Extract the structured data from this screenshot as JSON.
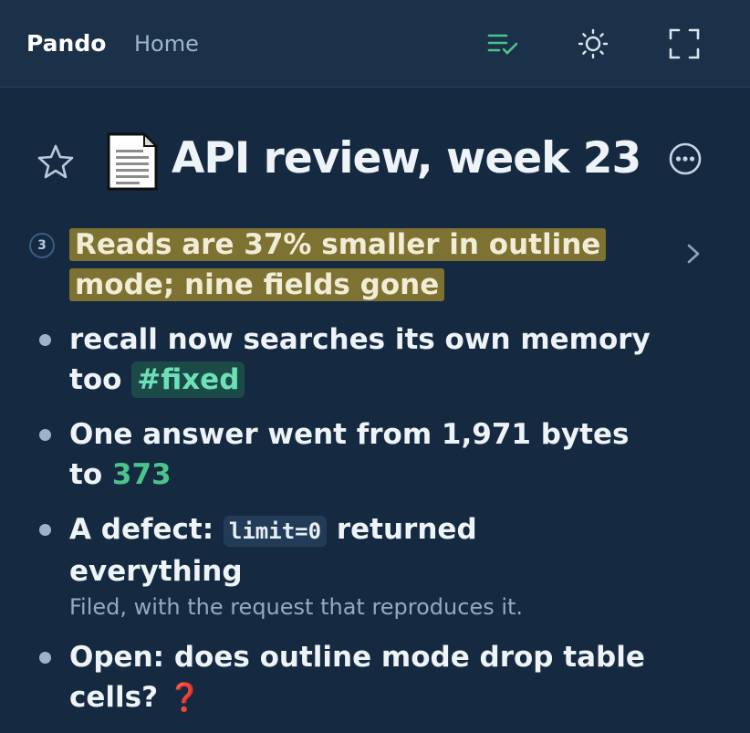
{
  "topbar": {
    "brand": "Pando",
    "home": "Home",
    "icons": {
      "outline": "outline-list-check-icon",
      "theme": "sun-icon",
      "fullscreen": "fullscreen-icon"
    },
    "accent": "#4cc38a"
  },
  "page": {
    "title": "API review, week 23",
    "doc_icon": "page-facing-up-icon"
  },
  "blocks": {
    "b1": {
      "children_count": "3",
      "text": "Reads are 37% smaller in outline mode; nine fields gone",
      "highlight_color": "#7d7231"
    },
    "b2": {
      "text": "recall now searches its own memory too",
      "tag": "#fixed"
    },
    "b3": {
      "text": "One answer went from 1,971 bytes to",
      "value": "373"
    },
    "b4": {
      "prefix": "A defect:",
      "code": "limit=0",
      "suffix": "returned everything",
      "note": "Filed, with the request that reproduces it."
    },
    "b5": {
      "text": "Open: does outline mode drop table cells?",
      "emoji": "❓"
    }
  }
}
